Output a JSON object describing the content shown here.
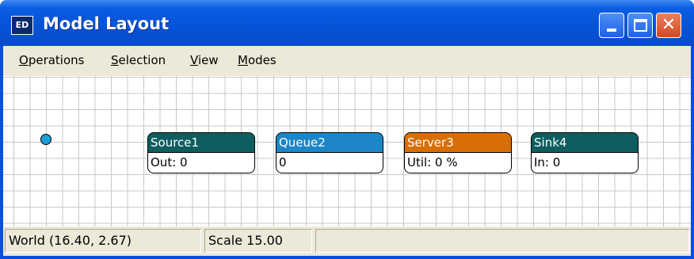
{
  "window": {
    "app_icon_text": "ED",
    "title": "Model Layout",
    "close_glyph": "✕"
  },
  "menu": {
    "items": [
      {
        "underline": "O",
        "rest": "perations"
      },
      {
        "underline": "S",
        "rest": "election"
      },
      {
        "underline": "V",
        "rest": "iew"
      },
      {
        "underline": "M",
        "rest": "odes"
      }
    ]
  },
  "canvas": {
    "nodes": [
      {
        "name": "Source1",
        "value": "Out: 0",
        "color": "#0e5e60"
      },
      {
        "name": "Queue2",
        "value": "0",
        "color": "#1c86c8"
      },
      {
        "name": "Server3",
        "value": "Util: 0 %",
        "color": "#d86f06"
      },
      {
        "name": "Sink4",
        "value": "In: 0",
        "color": "#0e5e60"
      }
    ]
  },
  "status": {
    "world": "World (16.40, 2.67)",
    "scale": "Scale 15.00",
    "extra": ""
  }
}
